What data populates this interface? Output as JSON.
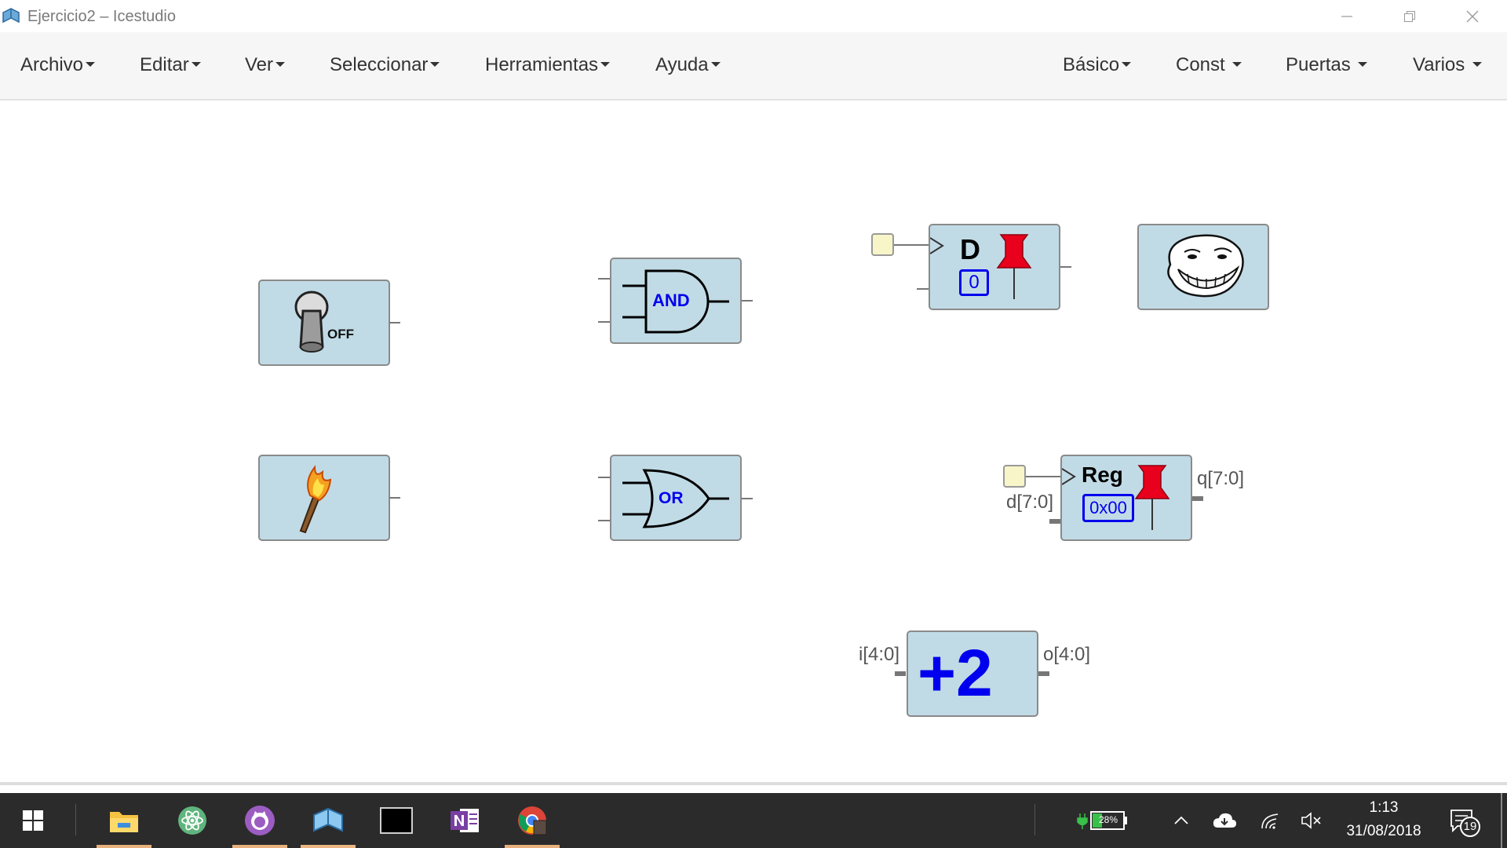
{
  "window": {
    "title": "Ejercicio2 – Icestudio",
    "minimize_icon": "minimize-icon",
    "restore_icon": "restore-icon",
    "close_icon": "close-icon"
  },
  "menu": {
    "left": [
      "Archivo",
      "Editar",
      "Ver",
      "Seleccionar",
      "Herramientas",
      "Ayuda"
    ],
    "right": [
      "Básico",
      "Const",
      "Puertas",
      "Varios"
    ]
  },
  "blocks": {
    "switch": {
      "label": "OFF"
    },
    "and_gate": {
      "label": "AND"
    },
    "or_gate": {
      "label": "OR"
    },
    "dff": {
      "label": "D",
      "init_value": "0"
    },
    "reg": {
      "label": "Reg",
      "init_value": "0x00",
      "input_label": "d[7:0]",
      "output_label": "q[7:0]"
    },
    "adder": {
      "label": "+2",
      "input_label": "i[4:0]",
      "output_label": "o[4:0]"
    }
  },
  "taskbar": {
    "apps": [
      "file-explorer-icon",
      "atom-icon",
      "github-desktop-icon",
      "icestudio-icon",
      "terminal-icon",
      "onenote-icon",
      "chrome-icon"
    ],
    "battery": "28%",
    "time": "1:13",
    "date": "31/08/2018",
    "notifications": "19"
  },
  "colors": {
    "block_fill": "#c1dbe6",
    "label_blue": "#0000ee",
    "pin_red": "#e8001c",
    "taskbar": "#2b2b2b"
  }
}
